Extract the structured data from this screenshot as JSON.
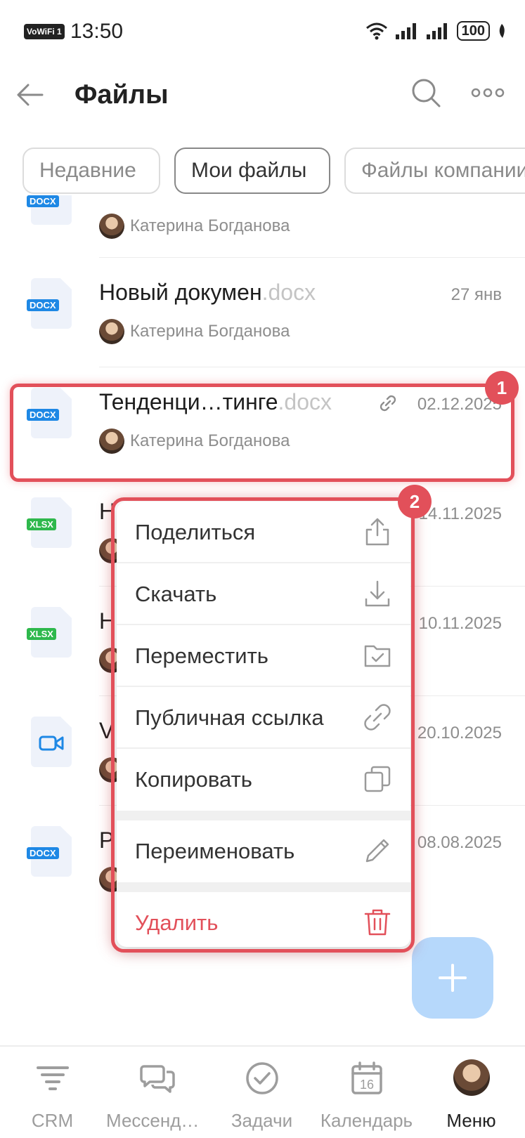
{
  "status_bar": {
    "vowifi": "VoWiFi",
    "vowifi_sim": "1",
    "time": "13:50",
    "battery": "100"
  },
  "header": {
    "title": "Файлы",
    "back_icon": "arrow-left-icon",
    "search_icon": "search-icon",
    "more_icon": "more-dots-icon"
  },
  "tabs": [
    {
      "label": "Недавние",
      "active": false
    },
    {
      "label": "Мои файлы",
      "active": true
    },
    {
      "label": "Файлы компании",
      "active": false
    }
  ],
  "files": [
    {
      "name": "",
      "ext": "",
      "type": "DOCX",
      "date": "",
      "owner": "Катерина Богданова",
      "shared": false
    },
    {
      "name": "Новый докумен",
      "ext": ".docx",
      "type": "DOCX",
      "date": "27 янв",
      "owner": "Катерина Богданова",
      "shared": false
    },
    {
      "name": "Тенденци…тинге",
      "ext": ".docx",
      "type": "DOCX",
      "date": "02.12.2025",
      "owner": "Катерина Богданова",
      "shared": true
    },
    {
      "name": "Н",
      "ext": "",
      "type": "XLSX",
      "date": "14.11.2025",
      "owner": "",
      "shared": false
    },
    {
      "name": "Н",
      "ext": "",
      "type": "XLSX",
      "date": "10.11.2025",
      "owner": "",
      "shared": false
    },
    {
      "name": "V",
      "ext": "",
      "type": "VIDEO",
      "date": "20.10.2025",
      "owner": "",
      "shared": false
    },
    {
      "name": "Р",
      "ext": "",
      "type": "DOCX",
      "date": "08.08.2025",
      "owner": "",
      "shared": false
    }
  ],
  "markers": {
    "one": "1",
    "two": "2"
  },
  "context_menu": {
    "share": {
      "label": "Поделиться",
      "icon": "share-icon"
    },
    "download": {
      "label": "Скачать",
      "icon": "download-icon"
    },
    "move": {
      "label": "Переместить",
      "icon": "folder-check-icon"
    },
    "public_link": {
      "label": "Публичная ссылка",
      "icon": "link-icon"
    },
    "copy": {
      "label": "Копировать",
      "icon": "copy-icon"
    },
    "rename": {
      "label": "Переименовать",
      "icon": "pencil-icon"
    },
    "delete": {
      "label": "Удалить",
      "icon": "trash-icon"
    }
  },
  "colors": {
    "accent_red": "#e2505a",
    "fab": "#b6d8fb",
    "docx": "#1e88e5",
    "xlsx": "#2eb84c"
  },
  "bottom_nav": [
    {
      "label": "CRM",
      "icon": "crm-funnel-icon",
      "active": false
    },
    {
      "label": "Мессендж…",
      "icon": "messenger-icon",
      "active": false
    },
    {
      "label": "Задачи",
      "icon": "tasks-check-icon",
      "active": false
    },
    {
      "label": "Календарь",
      "icon": "calendar-icon",
      "active": false,
      "badge": "16"
    },
    {
      "label": "Меню",
      "icon": "avatar",
      "active": true
    }
  ]
}
